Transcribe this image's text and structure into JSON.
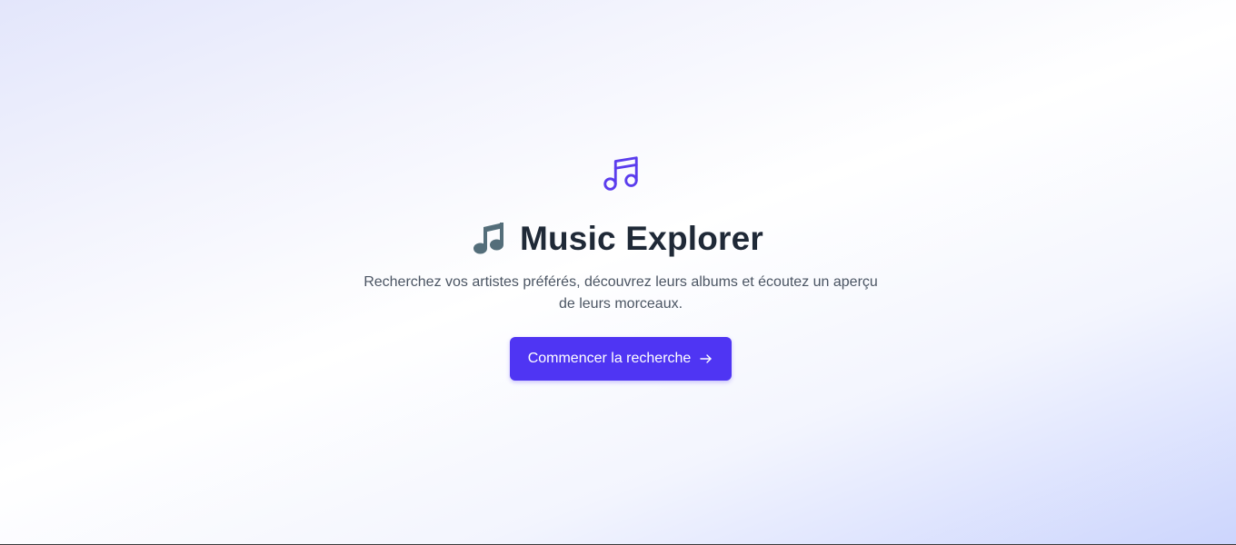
{
  "hero": {
    "icon": "music-note-icon",
    "title_emoji": "musical-note-emoji-icon",
    "title": "Music Explorer",
    "subtitle": "Recherchez vos artistes préférés, découvrez leurs albums et écoutez un aperçu de leurs morceaux.",
    "cta_label": "Commencer la recherche",
    "cta_icon": "arrow-right-icon"
  },
  "colors": {
    "accent": "#4f35f3",
    "title": "#1f2937",
    "subtitle": "#4b5563",
    "emoji": "#546e7a"
  }
}
